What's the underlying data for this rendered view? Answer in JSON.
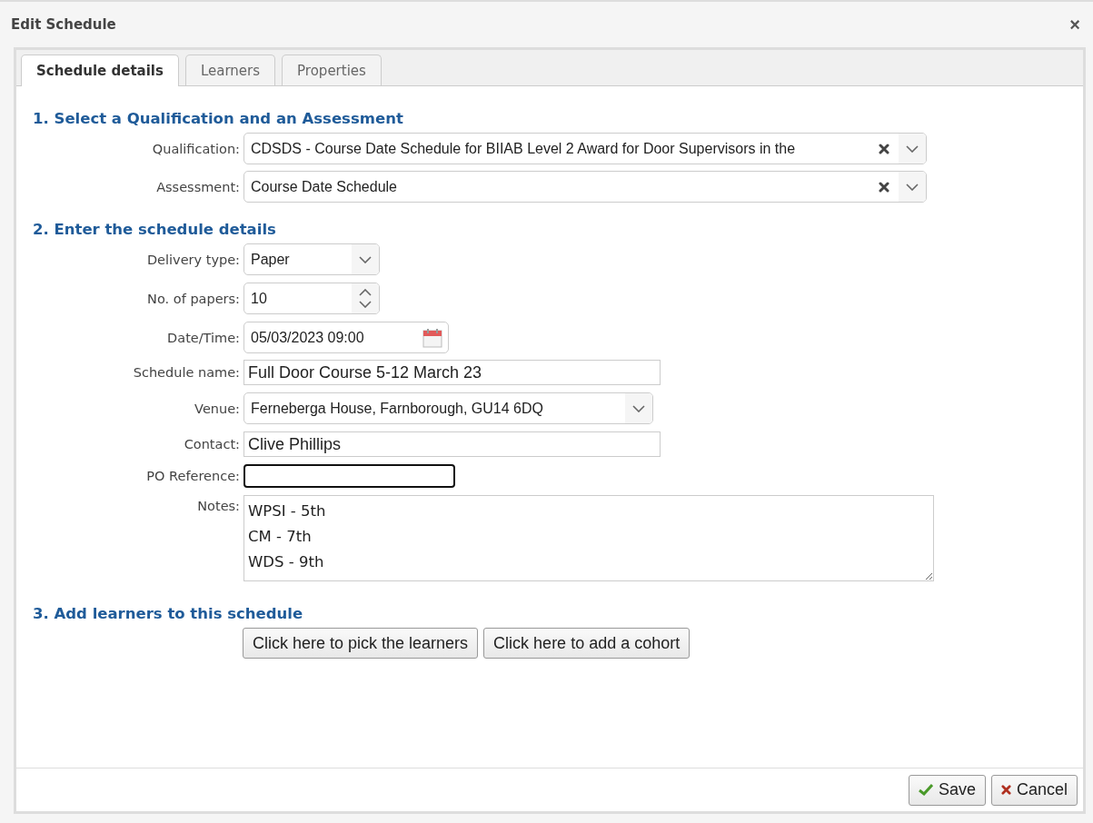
{
  "window": {
    "title": "Edit Schedule",
    "close": "×"
  },
  "tabs": [
    {
      "label": "Schedule details",
      "selected": true
    },
    {
      "label": "Learners",
      "selected": false
    },
    {
      "label": "Properties",
      "selected": false
    }
  ],
  "sections": [
    {
      "heading": "1. Select a Qualification and an Assessment",
      "fields": [
        {
          "kind": "combo",
          "label": "Qualification:",
          "value": "CDSDS - Course Date Schedule for BIIAB Level 2 Award for Door Supervisors in the"
        },
        {
          "kind": "combo",
          "label": "Assessment:",
          "value": "Course Date Schedule"
        }
      ]
    },
    {
      "heading": "2. Enter the schedule details",
      "fields": [
        {
          "kind": "select",
          "label": "Delivery type:",
          "value": "Paper"
        },
        {
          "kind": "number",
          "label": "No. of papers:",
          "value": "10"
        },
        {
          "kind": "date",
          "label": "Date/Time:",
          "value": "05/03/2023 09:00"
        },
        {
          "kind": "text",
          "label": "Schedule name:",
          "value": "Full Door Course 5-12 March 23",
          "focused": false
        },
        {
          "kind": "wideselect",
          "label": "Venue:",
          "value": "Ferneberga House, Farnborough, GU14 6DQ"
        },
        {
          "kind": "text",
          "label": "Contact:",
          "value": "Clive Phillips",
          "focused": false
        },
        {
          "kind": "text",
          "label": "PO Reference:",
          "focused": true
        },
        {
          "kind": "textarea",
          "label": "Notes:",
          "value": "WPSI - 5th\nCM - 7th\nWDS - 9th"
        }
      ]
    },
    {
      "heading": "3. Add learners to this schedule",
      "buttons": [
        "Click here to pick the learners",
        "Click here to add a cohort"
      ]
    }
  ],
  "footer": [
    {
      "kind": "save",
      "label": "Save"
    },
    {
      "kind": "cancel",
      "label": "Cancel"
    }
  ]
}
